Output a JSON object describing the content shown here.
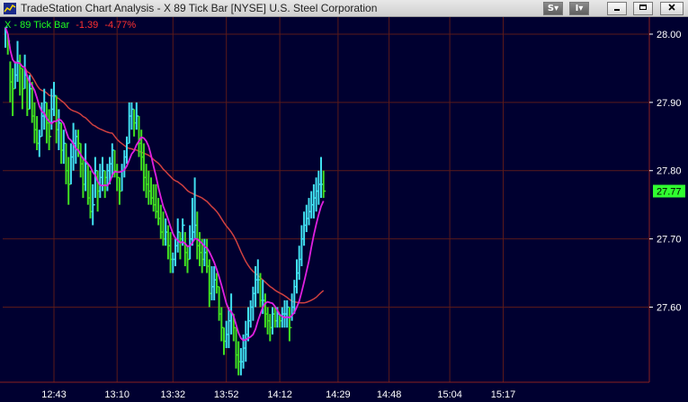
{
  "window": {
    "title": "TradeStation Chart Analysis - X 89 Tick Bar [NYSE] U.S. Steel Corporation",
    "buttons": [
      "S",
      "I"
    ],
    "controls": [
      "minimize",
      "restore",
      "close"
    ]
  },
  "legend": {
    "symbol": "X - 89 Tick Bar",
    "net_change": "-1.39",
    "pct_change": "-4.77%"
  },
  "colors": {
    "background": "#000030",
    "up_bar": "#40e0f0",
    "down_bar": "#40e020",
    "fast_ma": "#e020e0",
    "slow_ma": "#d04040",
    "grid": "#5a1a1a",
    "axis_text": "#ffffff",
    "last_price_box": "#30ff30"
  },
  "chart_data": {
    "type": "ohlc",
    "ylim": [
      27.49,
      28.025
    ],
    "y_ticks": [
      "28.00",
      "27.90",
      "27.80",
      "27.70",
      "27.60"
    ],
    "y_tick_values": [
      28.0,
      27.9,
      27.8,
      27.7,
      27.6
    ],
    "x_ticks": [
      "12:43",
      "13:10",
      "13:32",
      "13:52",
      "14:12",
      "14:29",
      "14:48",
      "15:04",
      "15:17"
    ],
    "x_tick_index": [
      20,
      46,
      69,
      91,
      113,
      137,
      158,
      183,
      205
    ],
    "last_price": "27.77",
    "last_price_value": 27.77,
    "bars": [
      [
        28.01,
        27.98,
        28.01
      ],
      [
        28.0,
        27.97,
        27.99
      ],
      [
        27.96,
        27.9,
        27.93
      ],
      [
        27.95,
        27.88,
        27.92
      ],
      [
        27.96,
        27.92,
        27.94
      ],
      [
        27.99,
        27.93,
        27.96
      ],
      [
        27.97,
        27.91,
        27.95
      ],
      [
        27.95,
        27.89,
        27.92
      ],
      [
        27.97,
        27.92,
        27.94
      ],
      [
        27.94,
        27.88,
        27.89
      ],
      [
        27.94,
        27.89,
        27.92
      ],
      [
        27.93,
        27.87,
        27.88
      ],
      [
        27.9,
        27.84,
        27.86
      ],
      [
        27.88,
        27.83,
        27.84
      ],
      [
        27.86,
        27.82,
        27.85
      ],
      [
        27.9,
        27.85,
        27.88
      ],
      [
        27.92,
        27.86,
        27.9
      ],
      [
        27.9,
        27.84,
        27.87
      ],
      [
        27.89,
        27.83,
        27.85
      ],
      [
        27.92,
        27.86,
        27.89
      ],
      [
        27.93,
        27.88,
        27.91
      ],
      [
        27.91,
        27.84,
        27.86
      ],
      [
        27.89,
        27.83,
        27.87
      ],
      [
        27.87,
        27.81,
        27.83
      ],
      [
        27.86,
        27.81,
        27.84
      ],
      [
        27.84,
        27.78,
        27.8
      ],
      [
        27.82,
        27.75,
        27.78
      ],
      [
        27.84,
        27.78,
        27.82
      ],
      [
        27.87,
        27.8,
        27.84
      ],
      [
        27.86,
        27.81,
        27.85
      ],
      [
        27.86,
        27.82,
        27.84
      ],
      [
        27.84,
        27.79,
        27.81
      ],
      [
        27.82,
        27.76,
        27.78
      ],
      [
        27.84,
        27.77,
        27.81
      ],
      [
        27.81,
        27.75,
        27.76
      ],
      [
        27.8,
        27.73,
        27.74
      ],
      [
        27.78,
        27.72,
        27.75
      ],
      [
        27.82,
        27.76,
        27.8
      ],
      [
        27.8,
        27.74,
        27.77
      ],
      [
        27.81,
        27.76,
        27.79
      ],
      [
        27.82,
        27.77,
        27.8
      ],
      [
        27.8,
        27.76,
        27.79
      ],
      [
        27.81,
        27.77,
        27.8
      ],
      [
        27.82,
        27.78,
        27.81
      ],
      [
        27.84,
        27.79,
        27.83
      ],
      [
        27.83,
        27.79,
        27.8
      ],
      [
        27.81,
        27.77,
        27.79
      ],
      [
        27.79,
        27.75,
        27.77
      ],
      [
        27.81,
        27.77,
        27.8
      ],
      [
        27.83,
        27.79,
        27.82
      ],
      [
        27.85,
        27.81,
        27.84
      ],
      [
        27.9,
        27.84,
        27.88
      ],
      [
        27.9,
        27.86,
        27.89
      ],
      [
        27.89,
        27.85,
        27.87
      ],
      [
        27.9,
        27.86,
        27.88
      ],
      [
        27.88,
        27.82,
        27.84
      ],
      [
        27.86,
        27.8,
        27.82
      ],
      [
        27.84,
        27.77,
        27.79
      ],
      [
        27.81,
        27.76,
        27.78
      ],
      [
        27.8,
        27.75,
        27.77
      ],
      [
        27.79,
        27.75,
        27.76
      ],
      [
        27.78,
        27.74,
        27.75
      ],
      [
        27.78,
        27.73,
        27.74
      ],
      [
        27.76,
        27.72,
        27.73
      ],
      [
        27.75,
        27.7,
        27.71
      ],
      [
        27.74,
        27.69,
        27.7
      ],
      [
        27.73,
        27.69,
        27.71
      ],
      [
        27.72,
        27.67,
        27.69
      ],
      [
        27.71,
        27.65,
        27.67
      ],
      [
        27.68,
        27.65,
        27.67
      ],
      [
        27.7,
        27.66,
        27.69
      ],
      [
        27.73,
        27.68,
        27.71
      ],
      [
        27.71,
        27.67,
        27.7
      ],
      [
        27.73,
        27.69,
        27.72
      ],
      [
        27.71,
        27.66,
        27.68
      ],
      [
        27.69,
        27.65,
        27.67
      ],
      [
        27.72,
        27.67,
        27.7
      ],
      [
        27.76,
        27.69,
        27.71
      ],
      [
        27.79,
        27.7,
        27.72
      ],
      [
        27.74,
        27.67,
        27.69
      ],
      [
        27.71,
        27.66,
        27.68
      ],
      [
        27.7,
        27.65,
        27.67
      ],
      [
        27.7,
        27.66,
        27.68
      ],
      [
        27.7,
        27.65,
        27.66
      ],
      [
        27.67,
        27.6,
        27.62
      ],
      [
        27.66,
        27.61,
        27.63
      ],
      [
        27.66,
        27.61,
        27.64
      ],
      [
        27.65,
        27.62,
        27.63
      ],
      [
        27.63,
        27.58,
        27.59
      ],
      [
        27.6,
        27.55,
        27.57
      ],
      [
        27.57,
        27.53,
        27.55
      ],
      [
        27.58,
        27.54,
        27.56
      ],
      [
        27.6,
        27.54,
        27.58
      ],
      [
        27.62,
        27.56,
        27.59
      ],
      [
        27.59,
        27.55,
        27.57
      ],
      [
        27.57,
        27.51,
        27.53
      ],
      [
        27.55,
        27.5,
        27.52
      ],
      [
        27.54,
        27.5,
        27.52
      ],
      [
        27.56,
        27.51,
        27.54
      ],
      [
        27.58,
        27.52,
        27.56
      ],
      [
        27.6,
        27.55,
        27.58
      ],
      [
        27.61,
        27.57,
        27.6
      ],
      [
        27.63,
        27.58,
        27.62
      ],
      [
        27.66,
        27.6,
        27.64
      ],
      [
        27.67,
        27.62,
        27.64
      ],
      [
        27.65,
        27.6,
        27.61
      ],
      [
        27.64,
        27.59,
        27.61
      ],
      [
        27.62,
        27.57,
        27.59
      ],
      [
        27.6,
        27.56,
        27.58
      ],
      [
        27.59,
        27.55,
        27.57
      ],
      [
        27.6,
        27.56,
        27.59
      ],
      [
        27.6,
        27.57,
        27.58
      ],
      [
        27.6,
        27.57,
        27.59
      ],
      [
        27.59,
        27.57,
        27.58
      ],
      [
        27.6,
        27.57,
        27.59
      ],
      [
        27.61,
        27.57,
        27.59
      ],
      [
        27.61,
        27.57,
        27.6
      ],
      [
        27.6,
        27.55,
        27.57
      ],
      [
        27.62,
        27.58,
        27.6
      ],
      [
        27.64,
        27.59,
        27.63
      ],
      [
        27.67,
        27.62,
        27.65
      ],
      [
        27.69,
        27.64,
        27.67
      ],
      [
        27.72,
        27.66,
        27.7
      ],
      [
        27.74,
        27.69,
        27.72
      ],
      [
        27.75,
        27.71,
        27.73
      ],
      [
        27.76,
        27.72,
        27.74
      ],
      [
        27.77,
        27.73,
        27.75
      ],
      [
        27.78,
        27.73,
        27.76
      ],
      [
        27.79,
        27.74,
        27.77
      ],
      [
        27.8,
        27.75,
        27.78
      ],
      [
        27.82,
        27.76,
        27.78
      ],
      [
        27.8,
        27.76,
        27.77
      ]
    ]
  }
}
